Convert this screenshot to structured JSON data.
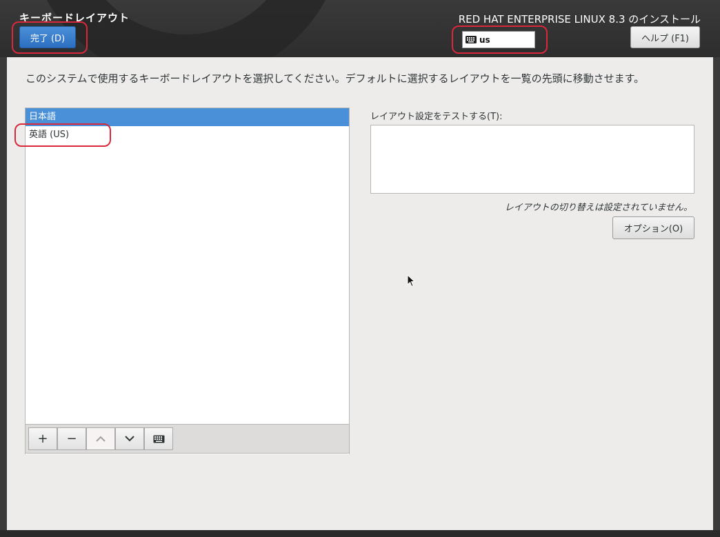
{
  "header": {
    "spoke_title": "キーボードレイアウト",
    "done_label": "完了 (D)",
    "product_title": "RED HAT ENTERPRISE LINUX 8.3 のインストール",
    "keyboard_indicator": "us",
    "help_label": "ヘルプ (F1)"
  },
  "main": {
    "instructions": "このシステムで使用するキーボードレイアウトを選択してください。デフォルトに選択するレイアウトを一覧の先頭に移動させます。",
    "layouts": [
      {
        "label": "日本語",
        "selected": true
      },
      {
        "label": "英語 (US)",
        "selected": false
      }
    ],
    "toolbar": {
      "add": "+",
      "remove": "−",
      "up": "︿",
      "down": "﹀",
      "preview_icon": "keyboard-icon"
    },
    "test_label": "レイアウト設定をテストする(T):",
    "switch_note": "レイアウトの切り替えは設定されていません。",
    "options_label": "オプション(O)"
  },
  "colors": {
    "accent": "#4a90d9",
    "annotation": "#d9283c",
    "header_bg": "#333333",
    "content_bg": "#edeceb"
  }
}
